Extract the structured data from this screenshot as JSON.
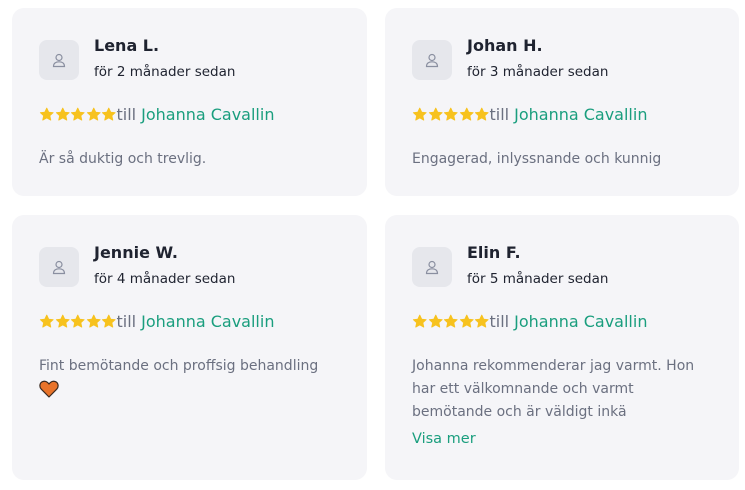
{
  "colors": {
    "card_bg": "#f5f5f8",
    "star": "#f7c21e",
    "accent": "#1a9e7e",
    "text_muted": "#6b7080",
    "text_dark": "#1f2330",
    "heart": "#e8732a"
  },
  "reviews": [
    {
      "name": "Lena L.",
      "time": "för 2 månader sedan",
      "stars": 5,
      "till": "till",
      "recipient": "Johanna Cavallin",
      "text": "Är så duktig och trevlig."
    },
    {
      "name": "Johan H.",
      "time": "för 3 månader sedan",
      "stars": 5,
      "till": "till",
      "recipient": "Johanna Cavallin",
      "text": "Engagerad, inlyssnande och kunnig"
    },
    {
      "name": "Jennie W.",
      "time": "för 4 månader sedan",
      "stars": 5,
      "till": "till",
      "recipient": "Johanna Cavallin",
      "text": "Fint bemötande och proffsig behandling",
      "emoji": "orange-heart-icon"
    },
    {
      "name": "Elin F.",
      "time": "för 5 månader sedan",
      "stars": 5,
      "till": "till",
      "recipient": "Johanna Cavallin",
      "text": "Johanna rekommenderar jag varmt. Hon har ett välkomnande och varmt bemötande och är väldigt inkä",
      "more_label": "Visa mer"
    }
  ]
}
